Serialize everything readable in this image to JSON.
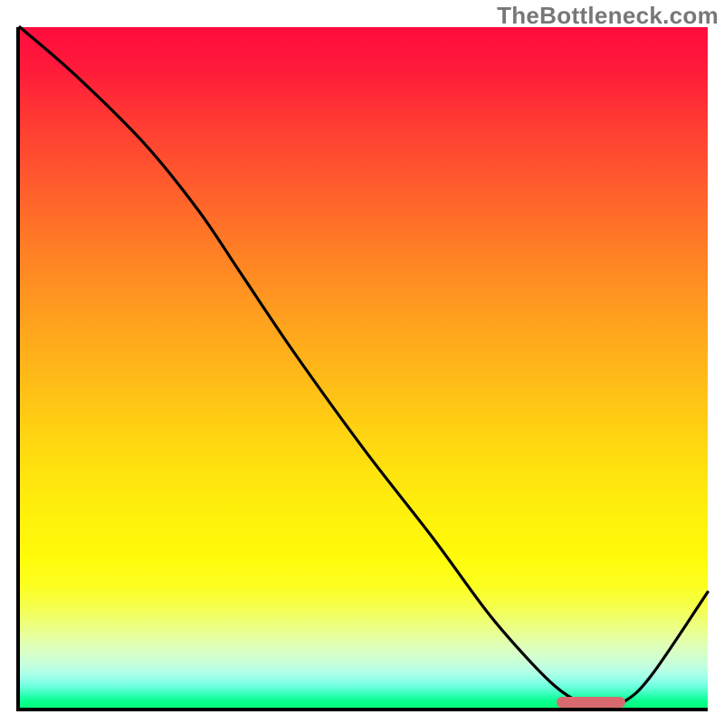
{
  "watermark": "TheBottleneck.com",
  "chart_data": {
    "type": "line",
    "title": "",
    "xlabel": "",
    "ylabel": "",
    "xlim": [
      0,
      100
    ],
    "ylim": [
      0,
      100
    ],
    "grid": false,
    "legend": false,
    "gradient_note": "vertical rainbow red→yellow→green representing bottleneck severity",
    "series": [
      {
        "name": "curve",
        "x": [
          0,
          8,
          18,
          26,
          32,
          40,
          50,
          60,
          68,
          74,
          78,
          81,
          84,
          88,
          92,
          100
        ],
        "values": [
          100,
          93,
          83,
          73,
          64,
          52,
          38,
          25,
          14,
          7,
          3,
          1,
          0,
          1,
          5,
          17
        ]
      }
    ],
    "marker": {
      "name": "optimal-range",
      "x_start": 78,
      "x_end": 88,
      "y": 0
    }
  }
}
